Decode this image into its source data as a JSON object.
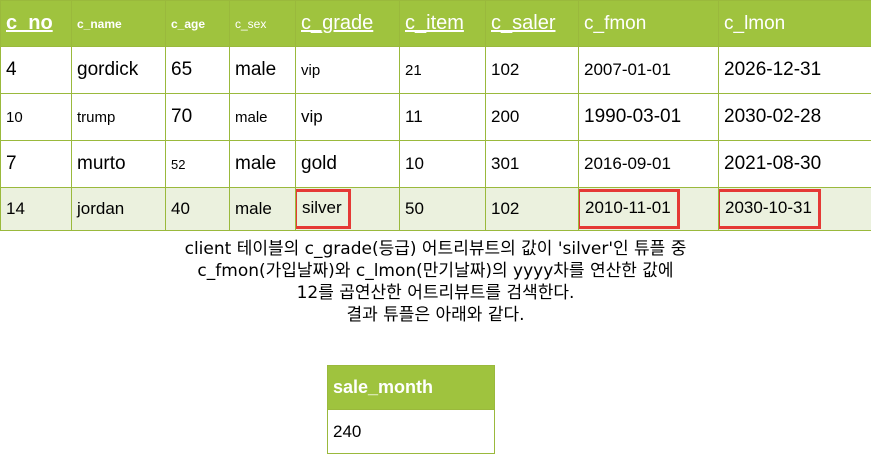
{
  "client_table": {
    "headers": [
      "c_no",
      "c_name",
      "c_age",
      "c_sex",
      "c_grade",
      "c_item",
      "c_saler",
      "c_fmon",
      "c_lmon"
    ],
    "rows": [
      [
        "4",
        "gordick",
        "65",
        "male",
        "vip",
        "21",
        "102",
        "2007-01-01",
        "2026-12-31"
      ],
      [
        "10",
        "trump",
        "70",
        "male",
        "vip",
        "11",
        "200",
        "1990-03-01",
        "2030-02-28"
      ],
      [
        "7",
        "murto",
        "52",
        "male",
        "gold",
        "10",
        "301",
        "2016-09-01",
        "2021-08-30"
      ],
      [
        "14",
        "jordan",
        "40",
        "male",
        "silver",
        "50",
        "102",
        "2010-11-01",
        "2030-10-31"
      ]
    ]
  },
  "description": {
    "line1": "client 테이블의 c_grade(등급) 어트리뷰트의 값이 'silver'인 튜플 중",
    "line2": "c_fmon(가입날짜)와 c_lmon(만기날짜)의 yyyy차를 연산한 값에",
    "line3": "12를 곱연산한 어트리뷰트를 검색한다.",
    "line4": "결과 튜플은 아래와 같다."
  },
  "result_table": {
    "header": "sale_month",
    "value": "240"
  },
  "colors": {
    "header_green": "#9fc33e",
    "border_green": "#9ab93c",
    "highlight_row": "#ebf1de",
    "highlight_box": "#e53935"
  }
}
